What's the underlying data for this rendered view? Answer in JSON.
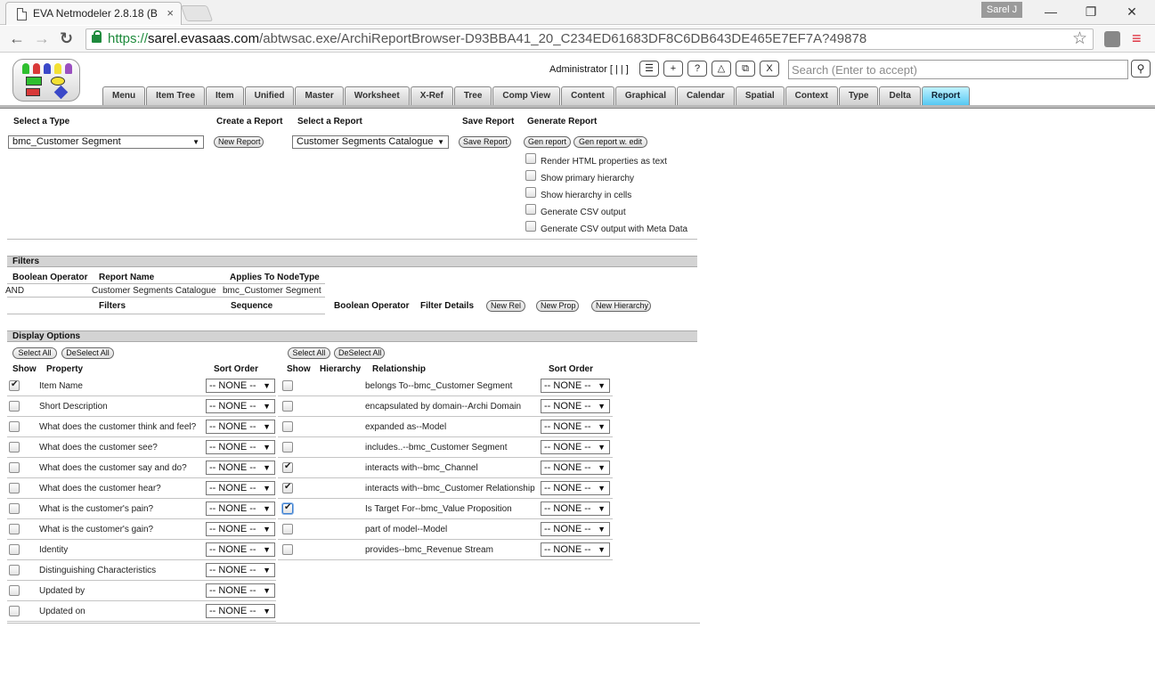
{
  "browser": {
    "tab_title": "EVA Netmodeler 2.8.18 (B",
    "tab_close": "×",
    "user": "Sarel J",
    "url_prefix": "https://",
    "url_host": "sarel.evasaas.com",
    "url_path": "/abtwsac.exe/ArchiReportBrowser-D93BBA41_20_C234ED61683DF8C6DB643DE465E7EF7A?49878",
    "back": "←",
    "forward": "→",
    "reload": "↻",
    "star": "☆",
    "menu": "≡",
    "minimize": "—",
    "maximize": "❐",
    "close": "✕"
  },
  "header": {
    "admin_label": "Administrator [ | | ]",
    "buttons": [
      "☰",
      "+",
      "?",
      "△",
      "⧉",
      "X"
    ],
    "search_placeholder": "Search (Enter to accept)",
    "search_button": "⚲"
  },
  "nav": {
    "tabs": [
      "Menu",
      "Item Tree",
      "Item",
      "Unified",
      "Master",
      "Worksheet",
      "X-Ref",
      "Tree",
      "Comp View",
      "Content",
      "Graphical",
      "Calendar",
      "Spatial",
      "Context",
      "Type",
      "Delta",
      "Report"
    ],
    "active": "Report"
  },
  "report": {
    "select_type_label": "Select a Type",
    "type_value": "bmc_Customer Segment",
    "create_report_label": "Create a Report",
    "new_report": "New Report",
    "select_report_label": "Select a Report",
    "report_value": "Customer Segments Catalogue",
    "save_report_label": "Save Report",
    "save_report_button": "Save Report",
    "generate_report_label": "Generate Report",
    "gen_report": "Gen report",
    "gen_report_edit": "Gen report w. edit",
    "options": [
      {
        "label": "Render HTML properties as text",
        "checked": false
      },
      {
        "label": "Show primary hierarchy",
        "checked": false
      },
      {
        "label": "Show hierarchy in cells",
        "checked": false
      },
      {
        "label": "Generate CSV output",
        "checked": false
      },
      {
        "label": "Generate CSV output with Meta Data",
        "checked": false
      }
    ],
    "dropdown_arrow": "▼"
  },
  "filters": {
    "title": "Filters",
    "col_boolean": "Boolean Operator",
    "col_report_name": "Report Name",
    "col_applies_to": "Applies To NodeType",
    "row_operator": "AND",
    "row_report_name": "Customer Segments Catalogue",
    "row_applies_to": "bmc_Customer Segment",
    "sub_filters": "Filters",
    "sub_sequence": "Sequence",
    "sub_boolean": "Boolean Operator",
    "sub_details": "Filter Details",
    "new_rel": "New Rel",
    "new_prop": "New Prop",
    "new_hierarchy": "New Hierarchy"
  },
  "display": {
    "title": "Display Options",
    "select_all": "Select All",
    "deselect_all": "DeSelect All",
    "col_show": "Show",
    "col_property": "Property",
    "col_sort_order": "Sort Order",
    "col_hierarchy": "Hierarchy",
    "col_relationship": "Relationship",
    "none_label": "-- NONE --",
    "properties": [
      {
        "label": "Item Name",
        "checked": true
      },
      {
        "label": "Short Description",
        "checked": false
      },
      {
        "label": "What does the customer think and feel?",
        "checked": false
      },
      {
        "label": "What does the customer see?",
        "checked": false
      },
      {
        "label": "What does the customer say and do?",
        "checked": false
      },
      {
        "label": "What does the customer hear?",
        "checked": false
      },
      {
        "label": "What is the customer's pain?",
        "checked": false
      },
      {
        "label": "What is the customer's gain?",
        "checked": false
      },
      {
        "label": "Identity",
        "checked": false
      },
      {
        "label": "Distinguishing Characteristics",
        "checked": false
      },
      {
        "label": "Updated by",
        "checked": false
      },
      {
        "label": "Updated on",
        "checked": false
      }
    ],
    "relationships": [
      {
        "label": "belongs To--bmc_Customer Segment",
        "checked": false
      },
      {
        "label": "encapsulated by domain--Archi Domain",
        "checked": false
      },
      {
        "label": "expanded as--Model",
        "checked": false
      },
      {
        "label": "includes..--bmc_Customer Segment",
        "checked": false
      },
      {
        "label": "interacts with--bmc_Channel",
        "checked": true
      },
      {
        "label": "interacts with--bmc_Customer Relationship",
        "checked": true
      },
      {
        "label": "Is Target For--bmc_Value Proposition",
        "checked": true
      },
      {
        "label": "part of model--Model",
        "checked": false
      },
      {
        "label": "provides--bmc_Revenue Stream",
        "checked": false
      }
    ]
  }
}
